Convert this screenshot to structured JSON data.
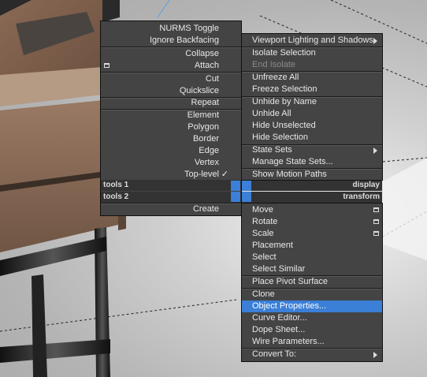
{
  "left_menu": {
    "items": [
      {
        "label": "NURMS Toggle"
      },
      {
        "label": "Ignore Backfacing"
      },
      {
        "label": "Collapse"
      },
      {
        "label": "Attach"
      },
      {
        "label": "Cut"
      },
      {
        "label": "Quickslice"
      },
      {
        "label": "Repeat"
      },
      {
        "label": "Element"
      },
      {
        "label": "Polygon"
      },
      {
        "label": "Border"
      },
      {
        "label": "Edge"
      },
      {
        "label": "Vertex"
      },
      {
        "label": "Top-level"
      },
      {
        "label": "Create"
      }
    ],
    "checkmark": "✓"
  },
  "quad_labels": {
    "tools1": "tools 1",
    "tools2": "tools 2",
    "display": "display",
    "transform": "transform"
  },
  "right_menu": {
    "items": [
      {
        "label": "Viewport Lighting and Shadows"
      },
      {
        "label": "Isolate Selection"
      },
      {
        "label": "End Isolate"
      },
      {
        "label": "Unfreeze All"
      },
      {
        "label": "Freeze Selection"
      },
      {
        "label": "Unhide by Name"
      },
      {
        "label": "Unhide All"
      },
      {
        "label": "Hide Unselected"
      },
      {
        "label": "Hide Selection"
      },
      {
        "label": "State Sets"
      },
      {
        "label": "Manage State Sets..."
      },
      {
        "label": "Show Motion Paths"
      },
      {
        "label": "Move"
      },
      {
        "label": "Rotate"
      },
      {
        "label": "Scale"
      },
      {
        "label": "Placement"
      },
      {
        "label": "Select"
      },
      {
        "label": "Select Similar"
      },
      {
        "label": "Place Pivot Surface"
      },
      {
        "label": "Clone"
      },
      {
        "label": "Object Properties..."
      },
      {
        "label": "Curve Editor..."
      },
      {
        "label": "Dope Sheet..."
      },
      {
        "label": "Wire Parameters..."
      },
      {
        "label": "Convert To:"
      }
    ]
  },
  "colors": {
    "menu_bg": "#444444",
    "highlight": "#3b7fd6",
    "disabled_text": "#8a8a8a"
  }
}
